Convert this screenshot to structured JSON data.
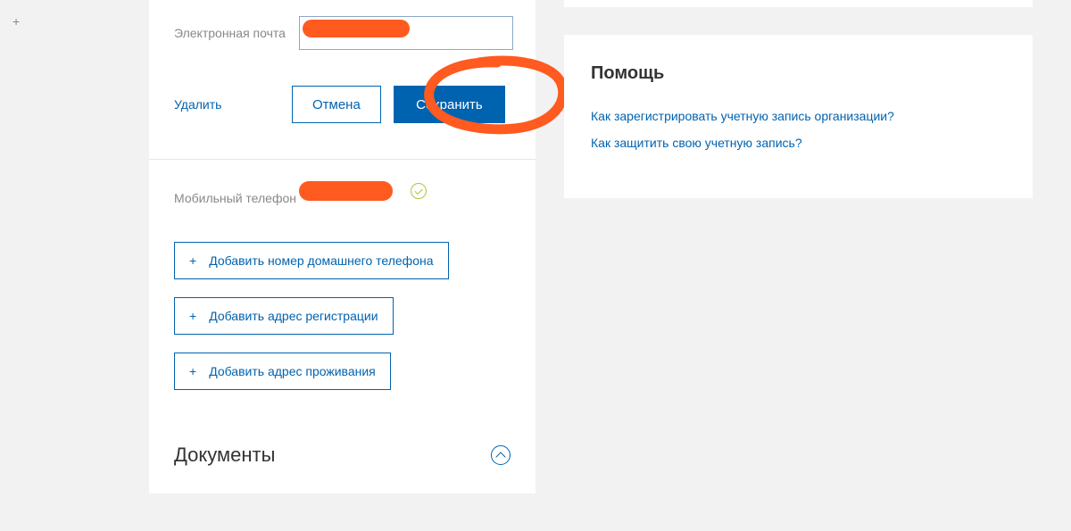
{
  "corner_plus": "+",
  "form": {
    "email_label": "Электронная почта",
    "email_value": "",
    "delete_label": "Удалить",
    "cancel_label": "Отмена",
    "save_label": "Сохранить",
    "phone_label": "Мобильный телефон",
    "phone_value": ""
  },
  "add_actions": {
    "home_phone": "Добавить номер домашнего телефона",
    "reg_address": "Добавить адрес регистрации",
    "res_address": "Добавить адрес проживания"
  },
  "documents_title": "Документы",
  "help": {
    "title": "Помощь",
    "link1": "Как зарегистрировать учетную запись организации?",
    "link2": "Как защитить свою учетную запись?"
  }
}
